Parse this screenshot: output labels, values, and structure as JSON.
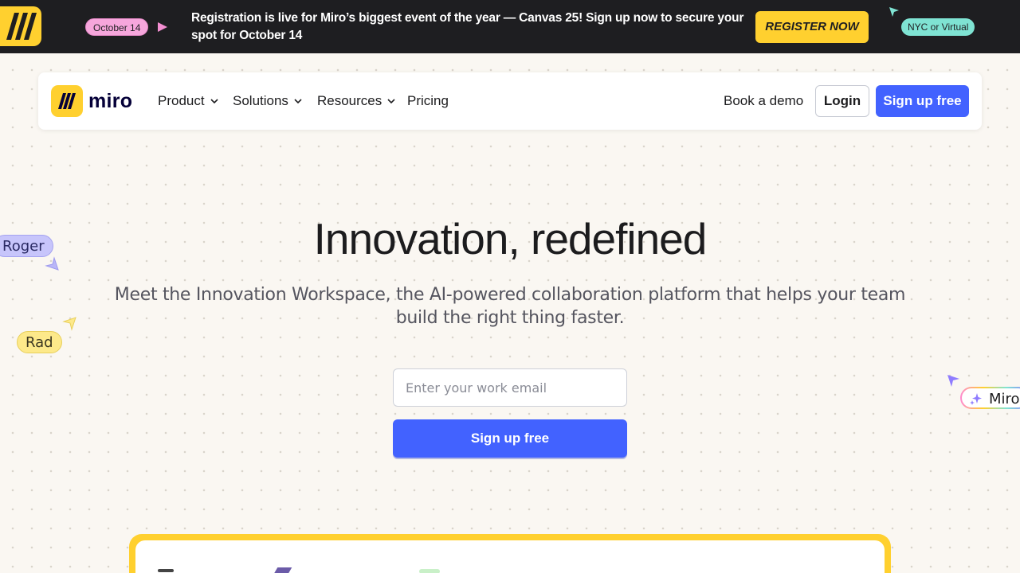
{
  "banner": {
    "date_pill": "October 14",
    "text": "Registration is live for Miro’s biggest event of the year — Canvas 25! Sign up now to secure your spot for October 14",
    "register_label": "REGISTER NOW",
    "location_pill": "NYC or Virtual"
  },
  "nav": {
    "logo_text": "miro",
    "items": [
      {
        "label": "Product",
        "has_dropdown": true
      },
      {
        "label": "Solutions",
        "has_dropdown": true
      },
      {
        "label": "Resources",
        "has_dropdown": true
      },
      {
        "label": "Pricing",
        "has_dropdown": false
      }
    ],
    "book_demo": "Book a demo",
    "login": "Login",
    "signup": "Sign up free"
  },
  "hero": {
    "title": "Innovation, redefined",
    "subtitle": "Meet the Innovation Workspace, the AI-powered collaboration platform that helps your team build the right thing faster.",
    "email_placeholder": "Enter your work email",
    "signup": "Sign up free"
  },
  "cursors": [
    {
      "name": "Roger",
      "color": "#c7c5fb"
    },
    {
      "name": "Rad",
      "color": "#fde98a"
    },
    {
      "name": "Miro",
      "color": "#ffffff"
    }
  ],
  "colors": {
    "brand_yellow": "#ffd02f",
    "primary_blue": "#4262ff",
    "banner_bg": "#1e1e21",
    "page_bg": "#faf7f2"
  },
  "icons": [
    "miro-logo-icon",
    "play-arrow-icon",
    "cursor-icon",
    "chevron-down-icon",
    "sparkle-icon"
  ]
}
